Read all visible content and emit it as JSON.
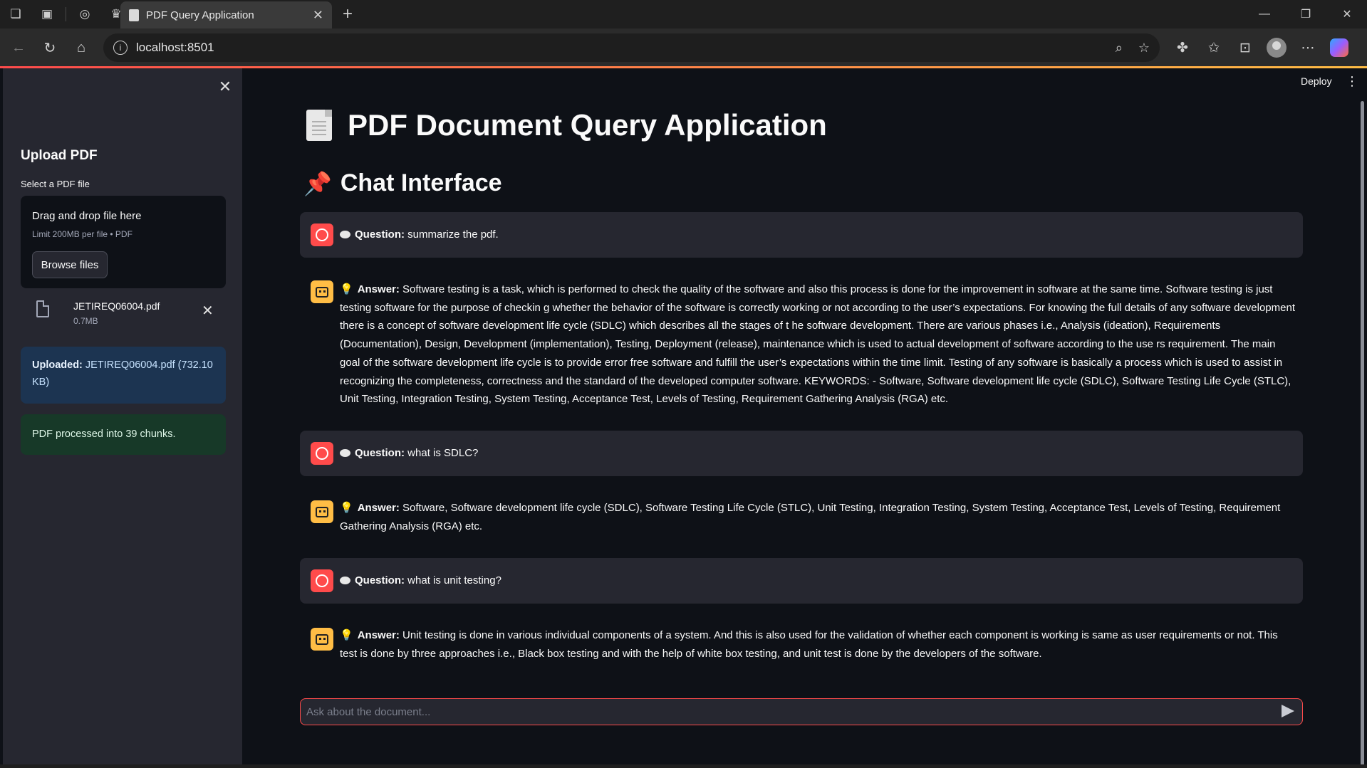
{
  "browser": {
    "tab_title": "PDF Query Application",
    "url": "localhost:8501"
  },
  "sidebar": {
    "title": "Upload PDF",
    "select_label": "Select a PDF file",
    "dropzone_title": "Drag and drop file here",
    "dropzone_limit": "Limit 200MB per file • PDF",
    "browse_label": "Browse files",
    "file_name": "JETIREQ06004.pdf",
    "file_size": "0.7MB",
    "uploaded_label": "Uploaded:",
    "uploaded_value": "JETIREQ06004.pdf (732.10 KB)",
    "processed_text": "PDF processed into 39 chunks."
  },
  "header": {
    "deploy_label": "Deploy"
  },
  "main": {
    "title": "PDF Document Query Application",
    "section_title": "Chat Interface",
    "question_label": "Question:",
    "answer_label": "Answer:",
    "messages": [
      {
        "role": "user",
        "text": "summarize the pdf."
      },
      {
        "role": "assistant",
        "text": "Software testing is a task, which is performed to check the quality of the software and also this process is done for the improvement in software at the same time. Software testing is just testing software for the purpose of checkin g whether the behavior of the software is correctly working or not according to the user’s expectations. For knowing the full details of any software development there is a concept of software development life cycle (SDLC) which describes all the stages of t he software development. There are various phases i.e., Analysis (ideation), Requirements (Documentation), Design, Development (implementation), Testing, Deployment (release), maintenance which is used to actual development of software according to the use rs requirement. The main goal of the software development life cycle is to provide error free software and fulfill the user’s expectations within the time limit. Testing of any software is basically a process which is used to assist in recognizing the completeness, correctness and the standard of the developed computer software. KEYWORDS: - Software, Software development life cycle (SDLC), Software Testing Life Cycle (STLC), Unit Testing, Integration Testing, System Testing, Acceptance Test, Levels of Testing, Requirement Gathering Analysis (RGA) etc."
      },
      {
        "role": "user",
        "text": "what is SDLC?"
      },
      {
        "role": "assistant",
        "text": "Software, Software development life cycle (SDLC), Software Testing Life Cycle (STLC), Unit Testing, Integration Testing, System Testing, Acceptance Test, Levels of Testing, Requirement Gathering Analysis (RGA) etc."
      },
      {
        "role": "user",
        "text": "what is unit testing?"
      },
      {
        "role": "assistant",
        "text": "Unit testing is done in various individual components of a system. And this is also used for the validation of whether each component is working is same as user requirements or not. This test is done by three approaches i.e., Black box testing and with the help of white box testing, and unit test is done by the developers of the software."
      }
    ],
    "chat_placeholder": "Ask about the document..."
  }
}
